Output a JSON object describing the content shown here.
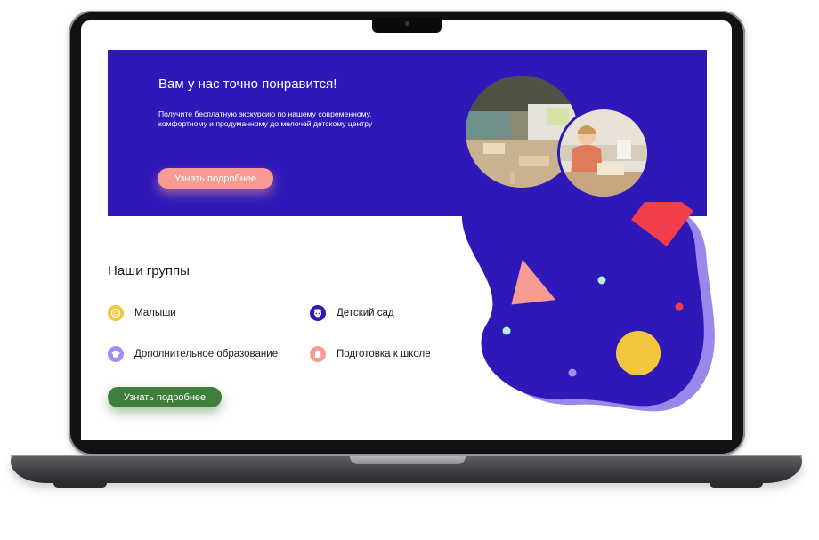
{
  "hero": {
    "title": "Вам у нас точно понравится!",
    "text": "Получите бесплатную экскурсию по нашему современному, комфортному и продуманному до мелочей детскому центру",
    "button": "Узнать подробнее"
  },
  "groups": {
    "title": "Наши группы",
    "items": [
      {
        "label": "Малыши",
        "icon": "smile-icon",
        "color": "#f4c63d"
      },
      {
        "label": "Детский сад",
        "icon": "kid-face-icon",
        "color": "#2e19b8"
      },
      {
        "label": "Дополнительное образование",
        "icon": "graduation-cap-icon",
        "color": "#a68ef1"
      },
      {
        "label": "Подготовка к школе",
        "icon": "hand-icon",
        "color": "#f69a93"
      }
    ],
    "button": "Узнать подробнее"
  },
  "colors": {
    "primary": "#2e19b8",
    "accent_pink": "#f69a93",
    "accent_green": "#3f7f3c",
    "accent_red": "#f23d4d",
    "accent_yellow": "#f4c63d"
  }
}
